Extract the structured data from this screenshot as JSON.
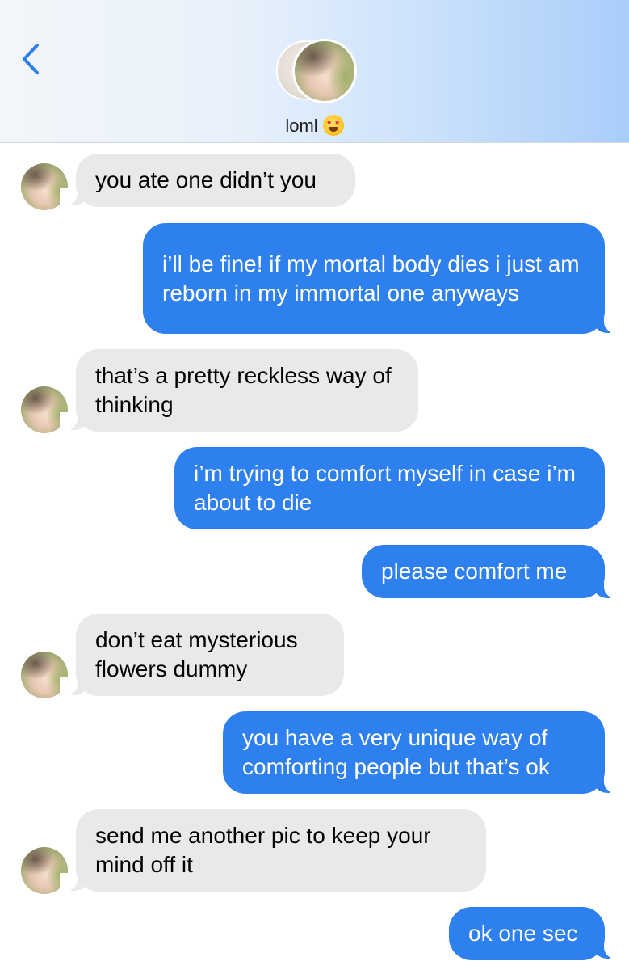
{
  "header": {
    "contact_name": "loml",
    "contact_emoji": "smiling-face-with-heart-eyes"
  },
  "colors": {
    "outgoing_bubble": "#2f80ef",
    "incoming_bubble": "#e9e9eb",
    "accent": "#2f80ef"
  },
  "messages": [
    {
      "direction": "incoming",
      "text": "you ate one didn’t you"
    },
    {
      "direction": "outgoing",
      "text": "i’ll be fine! if my mortal body dies i just am reborn in my immortal one anyways"
    },
    {
      "direction": "incoming",
      "text": "that’s a pretty reckless way of thinking"
    },
    {
      "direction": "outgoing",
      "text": "i’m trying to comfort myself in case i’m about to die"
    },
    {
      "direction": "outgoing",
      "text": "please comfort me"
    },
    {
      "direction": "incoming",
      "text": "don’t eat mysterious flowers dummy"
    },
    {
      "direction": "outgoing",
      "text": "you have a very unique way of comforting people but that’s ok"
    },
    {
      "direction": "incoming",
      "text": "send me another pic to keep your mind off it"
    },
    {
      "direction": "outgoing",
      "text": "ok one sec"
    }
  ]
}
